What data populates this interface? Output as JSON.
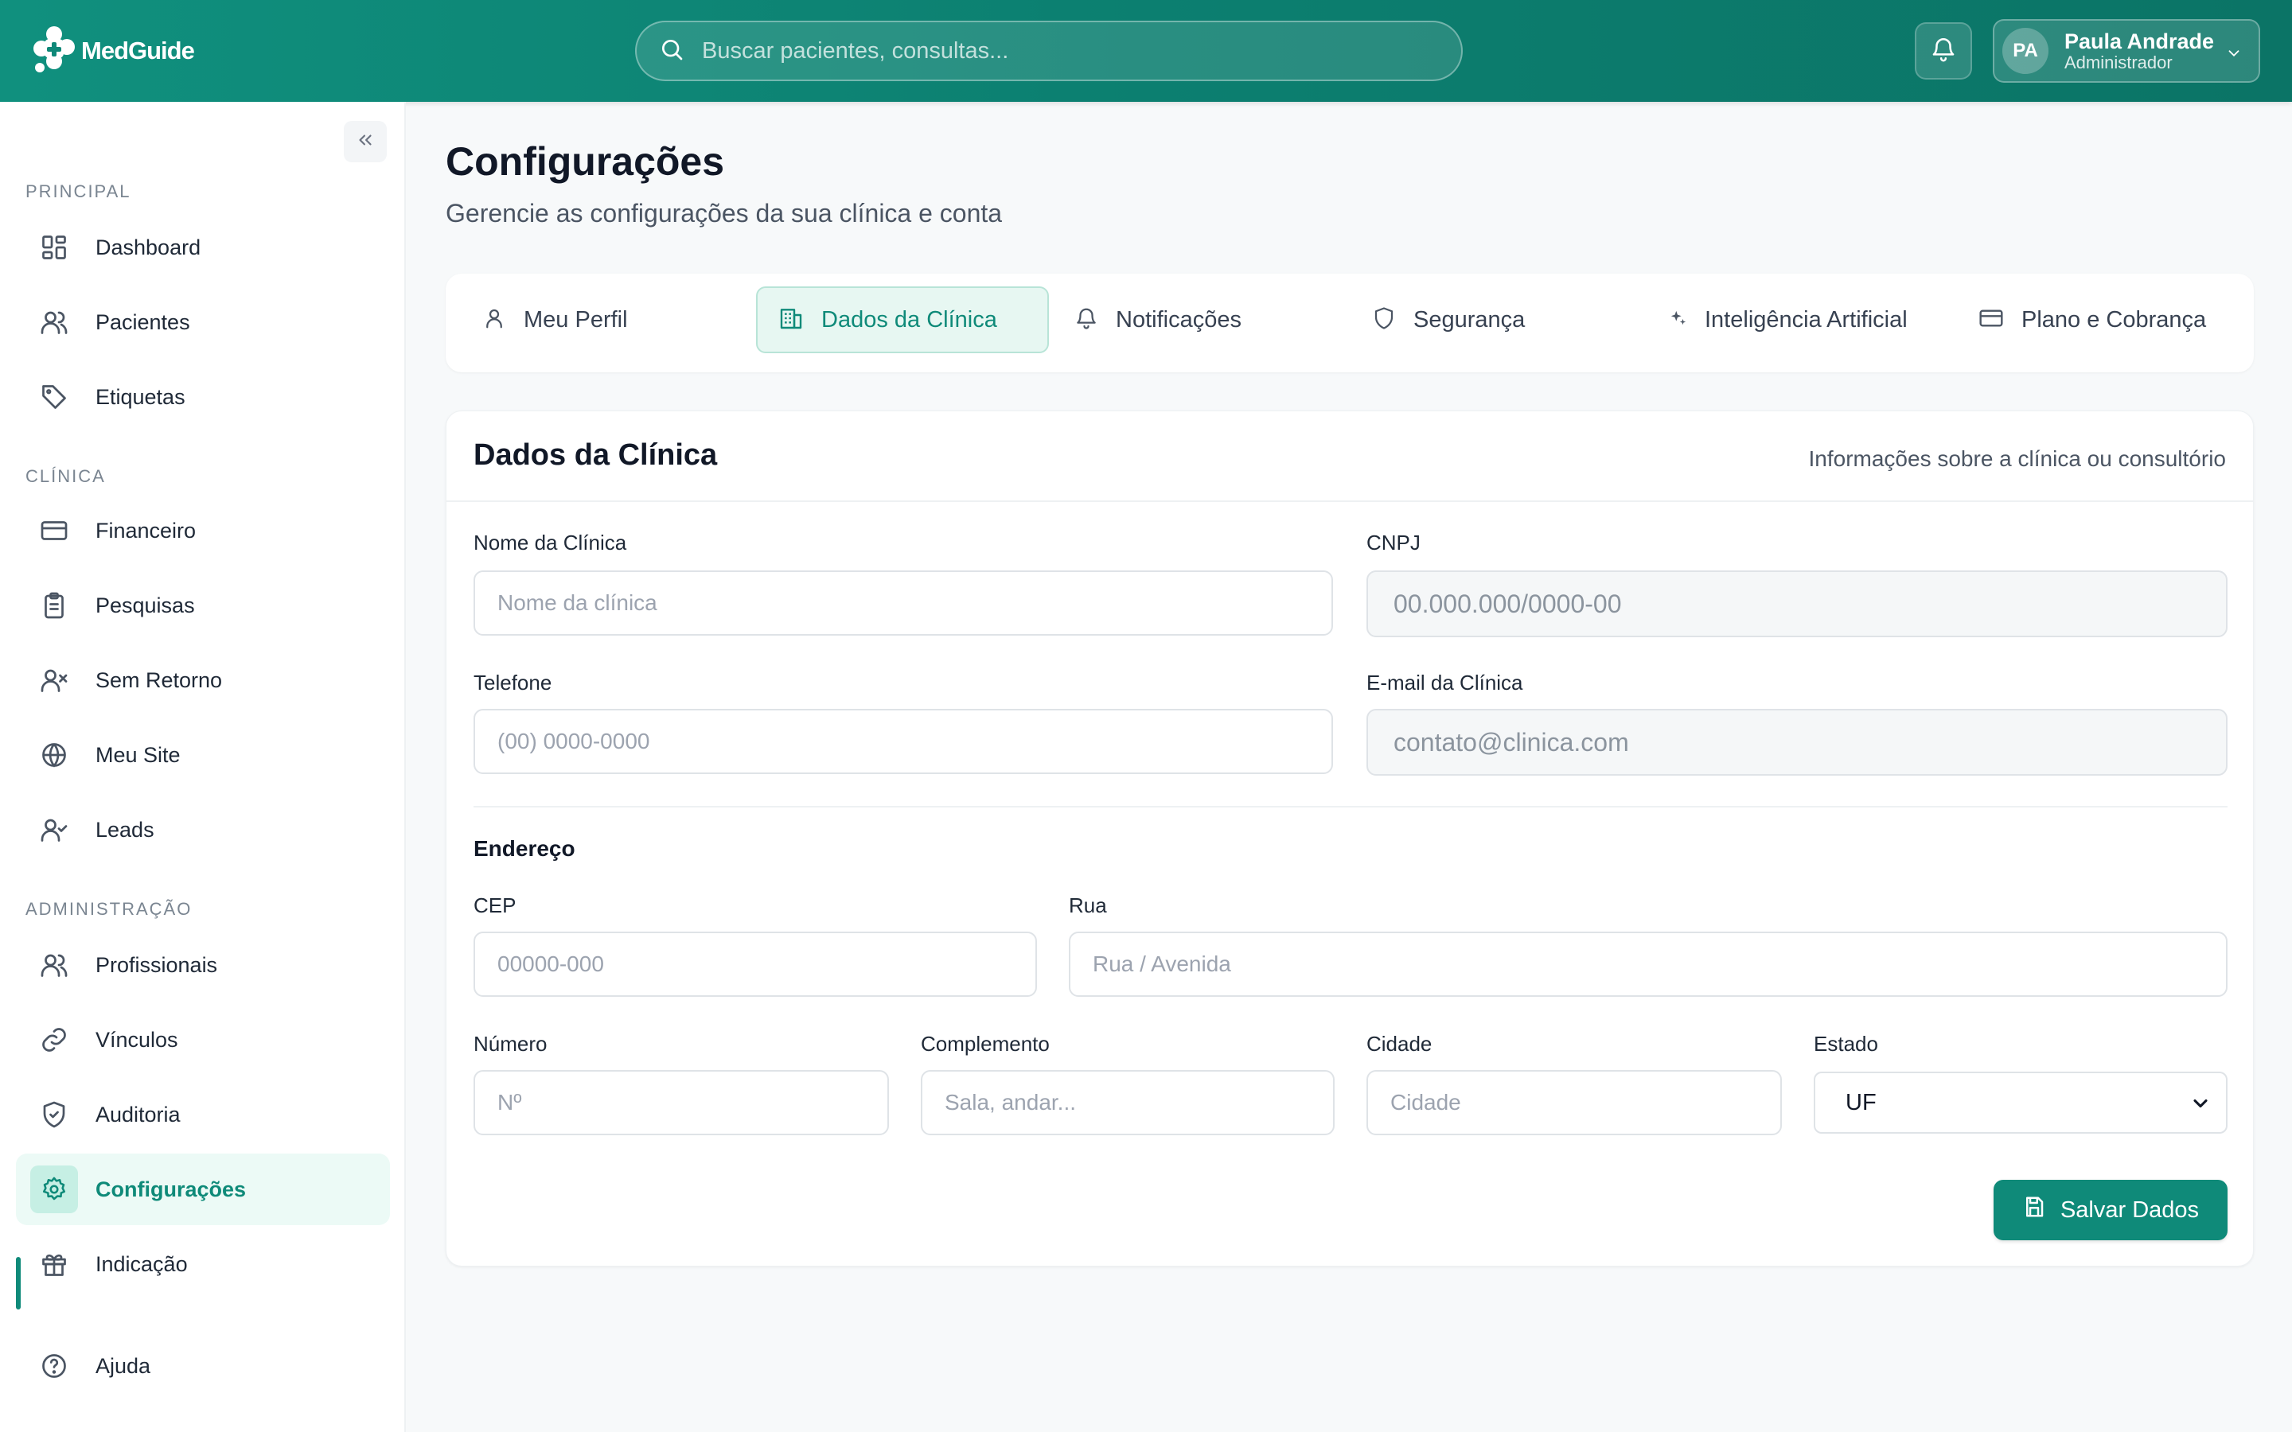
{
  "app": {
    "logo_text": "MedGuide",
    "brand_color": "#0f8a79"
  },
  "header": {
    "search_placeholder": "Buscar pacientes, consultas...",
    "user": {
      "initials": "PA",
      "name": "Paula Andrade",
      "role": "Administrador"
    }
  },
  "sidebar": {
    "sections": {
      "principal": "PRINCIPAL",
      "clinica": "CLÍNICA",
      "administracao": "ADMINISTRAÇÃO"
    },
    "items": {
      "dashboard": "Dashboard",
      "pacientes": "Pacientes",
      "etiquetas": "Etiquetas",
      "financeiro": "Financeiro",
      "pesquisas": "Pesquisas",
      "sem_retorno": "Sem Retorno",
      "meu_site": "Meu Site",
      "leads": "Leads",
      "profissionais": "Profissionais",
      "vinculos": "Vínculos",
      "auditoria": "Auditoria",
      "configuracoes": "Configurações",
      "indicacao": "Indicação",
      "ajuda": "Ajuda"
    },
    "active": "configuracoes"
  },
  "page": {
    "title": "Configurações",
    "subtitle": "Gerencie as configurações da sua clínica e conta"
  },
  "tabs": {
    "meu_perfil": "Meu Perfil",
    "dados_clinica": "Dados da Clínica",
    "notificacoes": "Notificações",
    "seguranca": "Segurança",
    "ia": "Inteligência Artificial",
    "plano": "Plano e Cobrança",
    "active": "dados_clinica"
  },
  "card": {
    "title": "Dados da Clínica",
    "description": "Informações sobre a clínica ou consultório",
    "fields": {
      "nome": {
        "label": "Nome da Clínica",
        "placeholder": "Nome da clínica"
      },
      "cnpj": {
        "label": "CNPJ",
        "placeholder": "00.000.000/0000-00"
      },
      "telefone": {
        "label": "Telefone",
        "placeholder": "(00) 0000-0000"
      },
      "email": {
        "label": "E-mail da Clínica",
        "placeholder": "contato@clinica.com"
      }
    },
    "address": {
      "title": "Endereço",
      "cep": {
        "label": "CEP",
        "placeholder": "00000-000"
      },
      "rua": {
        "label": "Rua",
        "placeholder": "Rua / Avenida"
      },
      "numero": {
        "label": "Número",
        "placeholder": "Nº"
      },
      "complemento": {
        "label": "Complemento",
        "placeholder": "Sala, andar..."
      },
      "cidade": {
        "label": "Cidade",
        "placeholder": "Cidade"
      },
      "estado": {
        "label": "Estado",
        "selected": "UF"
      }
    },
    "save_label": "Salvar Dados"
  }
}
